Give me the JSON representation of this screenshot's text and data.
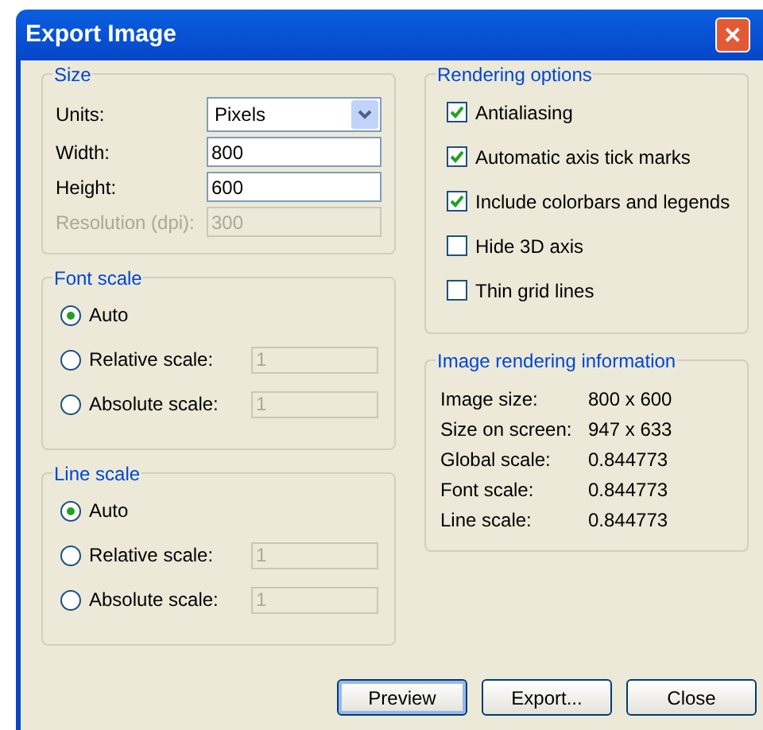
{
  "window": {
    "title": "Export Image",
    "close": "✕"
  },
  "size": {
    "title": "Size",
    "fields": [
      {
        "kind": "select",
        "label": "Units:",
        "value": "Pixels",
        "disabled": false
      },
      {
        "kind": "text",
        "label": "Width:",
        "value": "800",
        "disabled": false
      },
      {
        "kind": "text",
        "label": "Height:",
        "value": "600",
        "disabled": false
      },
      {
        "kind": "text",
        "label": "Resolution (dpi):",
        "value": "300",
        "disabled": true
      }
    ]
  },
  "font_scale": {
    "title": "Font scale",
    "options": [
      {
        "label": "Auto",
        "selected": true
      },
      {
        "label": "Relative scale:",
        "selected": false,
        "value": "1"
      },
      {
        "label": "Absolute scale:",
        "selected": false,
        "value": "1"
      }
    ]
  },
  "line_scale": {
    "title": "Line scale",
    "options": [
      {
        "label": "Auto",
        "selected": true
      },
      {
        "label": "Relative scale:",
        "selected": false,
        "value": "1"
      },
      {
        "label": "Absolute scale:",
        "selected": false,
        "value": "1"
      }
    ]
  },
  "rendering_options": {
    "title": "Rendering options",
    "items": [
      {
        "label": "Antialiasing",
        "checked": true
      },
      {
        "label": "Automatic axis tick marks",
        "checked": true
      },
      {
        "label": "Include colorbars and legends",
        "checked": true
      },
      {
        "label": "Hide 3D axis",
        "checked": false
      },
      {
        "label": "Thin grid lines",
        "checked": false
      }
    ]
  },
  "image_info": {
    "title": "Image rendering information",
    "rows": [
      {
        "label": "Image size:",
        "value": "800 x 600"
      },
      {
        "label": "Size on screen:",
        "value": "947 x 633"
      },
      {
        "label": "Global scale:",
        "value": "0.844773"
      },
      {
        "label": "Font scale:",
        "value": "0.844773"
      },
      {
        "label": "Line scale:",
        "value": "0.844773"
      }
    ]
  },
  "buttons": [
    {
      "label": "Preview",
      "focused": true
    },
    {
      "label": "Export...",
      "focused": false
    },
    {
      "label": "Close",
      "focused": false
    }
  ]
}
